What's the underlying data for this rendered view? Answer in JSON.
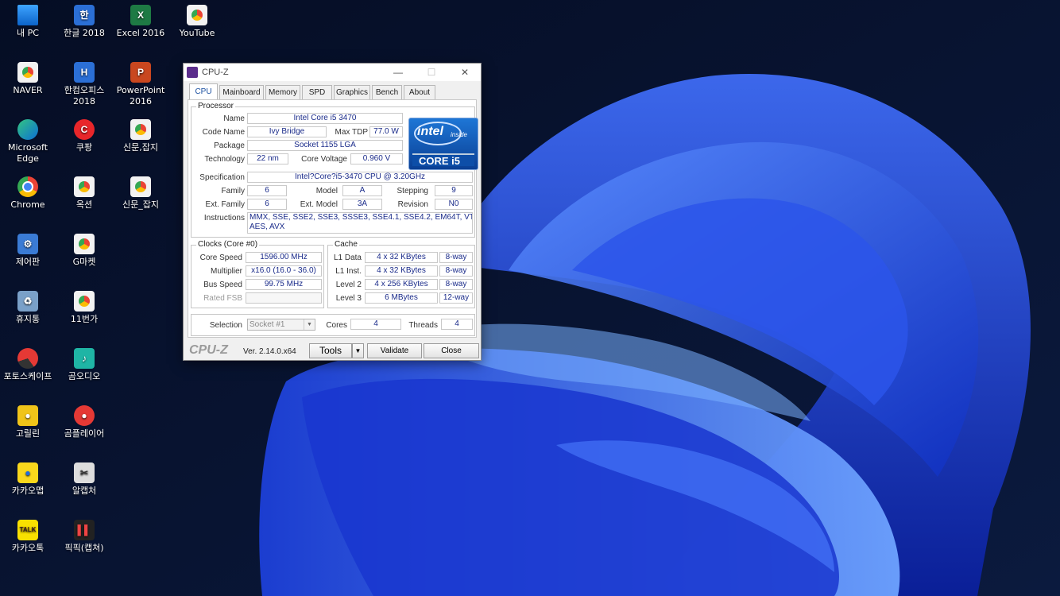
{
  "desktop": {
    "icons": [
      {
        "label": "내 PC",
        "icon": "pc-icon",
        "glyph": ""
      },
      {
        "label": "한글 2018",
        "icon": "hwp-icon",
        "glyph": "한"
      },
      {
        "label": "Excel 2016",
        "icon": "excel-icon",
        "glyph": "X"
      },
      {
        "label": "YouTube",
        "icon": "chrome-shortcut-icon",
        "glyph": ""
      },
      {
        "label": "NAVER",
        "icon": "chrome-shortcut-icon",
        "glyph": ""
      },
      {
        "label": "한컴오피스 2018",
        "icon": "hancom-office-icon",
        "glyph": "H"
      },
      {
        "label": "PowerPoint 2016",
        "icon": "powerpoint-icon",
        "glyph": "P"
      },
      {
        "label": "Microsoft Edge",
        "icon": "edge-icon",
        "glyph": ""
      },
      {
        "label": "쿠팡",
        "icon": "coupang-icon",
        "glyph": "C"
      },
      {
        "label": "신문,잡지",
        "icon": "chrome-shortcut-icon",
        "glyph": ""
      },
      {
        "label": "Chrome",
        "icon": "chrome-icon",
        "glyph": ""
      },
      {
        "label": "옥션",
        "icon": "chrome-shortcut-icon",
        "glyph": ""
      },
      {
        "label": "신문_잡지",
        "icon": "chrome-shortcut-icon",
        "glyph": ""
      },
      {
        "label": "제어판",
        "icon": "control-panel-icon",
        "glyph": "⚙"
      },
      {
        "label": "G마켓",
        "icon": "chrome-shortcut-icon",
        "glyph": ""
      },
      {
        "label": "휴지통",
        "icon": "recycle-bin-icon",
        "glyph": "♻"
      },
      {
        "label": "11번가",
        "icon": "chrome-shortcut-icon",
        "glyph": ""
      },
      {
        "label": "포토스케이프",
        "icon": "photoscape-icon",
        "glyph": ""
      },
      {
        "label": "곰오디오",
        "icon": "gom-audio-icon",
        "glyph": "♪"
      },
      {
        "label": "고릴린",
        "icon": "gorilla-icon",
        "glyph": "●"
      },
      {
        "label": "곰플레이어",
        "icon": "gom-player-icon",
        "glyph": "●"
      },
      {
        "label": "카카오맵",
        "icon": "kakaomap-icon",
        "glyph": "●"
      },
      {
        "label": "알캡처",
        "icon": "alcapture-icon",
        "glyph": "✂"
      },
      {
        "label": "카카오톡",
        "icon": "kakaotalk-icon",
        "glyph": "TALK"
      },
      {
        "label": "픽픽(캡쳐)",
        "icon": "picpick-icon",
        "glyph": "▌▌"
      }
    ]
  },
  "window": {
    "title": "CPU-Z",
    "controls": {
      "minimize": "—",
      "maximize": "☐",
      "close": "✕"
    },
    "tabs": [
      "CPU",
      "Mainboard",
      "Memory",
      "SPD",
      "Graphics",
      "Bench",
      "About"
    ],
    "active_tab": "CPU"
  },
  "processor": {
    "group_label": "Processor",
    "name_label": "Name",
    "name": "Intel Core i5 3470",
    "codename_label": "Code Name",
    "codename": "Ivy Bridge",
    "maxtdp_label": "Max TDP",
    "maxtdp": "77.0 W",
    "package_label": "Package",
    "package": "Socket 1155 LGA",
    "technology_label": "Technology",
    "technology": "22 nm",
    "corevoltage_label": "Core Voltage",
    "corevoltage": "0.960 V",
    "specification_label": "Specification",
    "specification": "Intel?Core?i5-3470 CPU @ 3.20GHz",
    "family_label": "Family",
    "family": "6",
    "model_label": "Model",
    "model": "A",
    "stepping_label": "Stepping",
    "stepping": "9",
    "extfamily_label": "Ext. Family",
    "extfamily": "6",
    "extmodel_label": "Ext. Model",
    "extmodel": "3A",
    "revision_label": "Revision",
    "revision": "N0",
    "instructions_label": "Instructions",
    "instructions_line1": "MMX, SSE, SSE2, SSE3, SSSE3, SSE4.1, SSE4.2, EM64T, VT-x,",
    "instructions_line2": "AES, AVX",
    "logo": {
      "brand": "intel",
      "inside": "inside",
      "line": "CORE i5"
    }
  },
  "clocks": {
    "group_label": "Clocks (Core #0)",
    "corespeed_label": "Core Speed",
    "corespeed": "1596.00 MHz",
    "multiplier_label": "Multiplier",
    "multiplier": "x16.0 (16.0 - 36.0)",
    "busspeed_label": "Bus Speed",
    "busspeed": "99.75 MHz",
    "ratedfsb_label": "Rated FSB",
    "ratedfsb": ""
  },
  "cache": {
    "group_label": "Cache",
    "l1data_label": "L1 Data",
    "l1data": "4 x 32 KBytes",
    "l1data_way": "8-way",
    "l1inst_label": "L1 Inst.",
    "l1inst": "4 x 32 KBytes",
    "l1inst_way": "8-way",
    "level2_label": "Level 2",
    "level2": "4 x 256 KBytes",
    "level2_way": "8-way",
    "level3_label": "Level 3",
    "level3": "6 MBytes",
    "level3_way": "12-way"
  },
  "selection": {
    "selection_label": "Selection",
    "socket": "Socket #1",
    "cores_label": "Cores",
    "cores": "4",
    "threads_label": "Threads",
    "threads": "4"
  },
  "footer": {
    "logo": "CPU-Z",
    "version": "Ver. 2.14.0.x64",
    "tools": "Tools",
    "tools_arrow": "▼",
    "validate": "Validate",
    "close": "Close"
  }
}
